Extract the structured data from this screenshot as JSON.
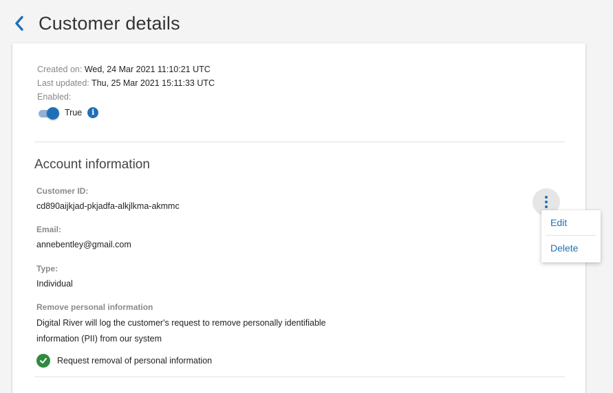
{
  "header": {
    "title": "Customer details"
  },
  "meta": {
    "created_label": "Created on:",
    "created_value": "Wed, 24 Mar 2021 11:10:21 UTC",
    "updated_label": "Last updated:",
    "updated_value": "Thu, 25 Mar 2021 15:11:33 UTC",
    "enabled_label": "Enabled:",
    "enabled_value": "True"
  },
  "account": {
    "title": "Account information",
    "customer_id_label": "Customer ID:",
    "customer_id_value": "cd890aijkjad-pkjadfa-alkjlkma-akmmc",
    "email_label": "Email:",
    "email_value": "annebentley@gmail.com",
    "type_label": "Type:",
    "type_value": "Individual",
    "pii_label": "Remove personal information",
    "pii_line1": "Digital River will log the customer's request to remove personally identifiable",
    "pii_line2": "information (PII) from our system",
    "pii_check_text": "Request removal of personal information"
  },
  "menu": {
    "edit": "Edit",
    "delete": "Delete"
  },
  "icons": {
    "back": "chevron-left-icon",
    "info": "info-icon",
    "kebab": "more-vertical-icon",
    "check": "check-circle-icon"
  },
  "colors": {
    "accent": "#1f6fb8",
    "success": "#2e8b3e"
  }
}
